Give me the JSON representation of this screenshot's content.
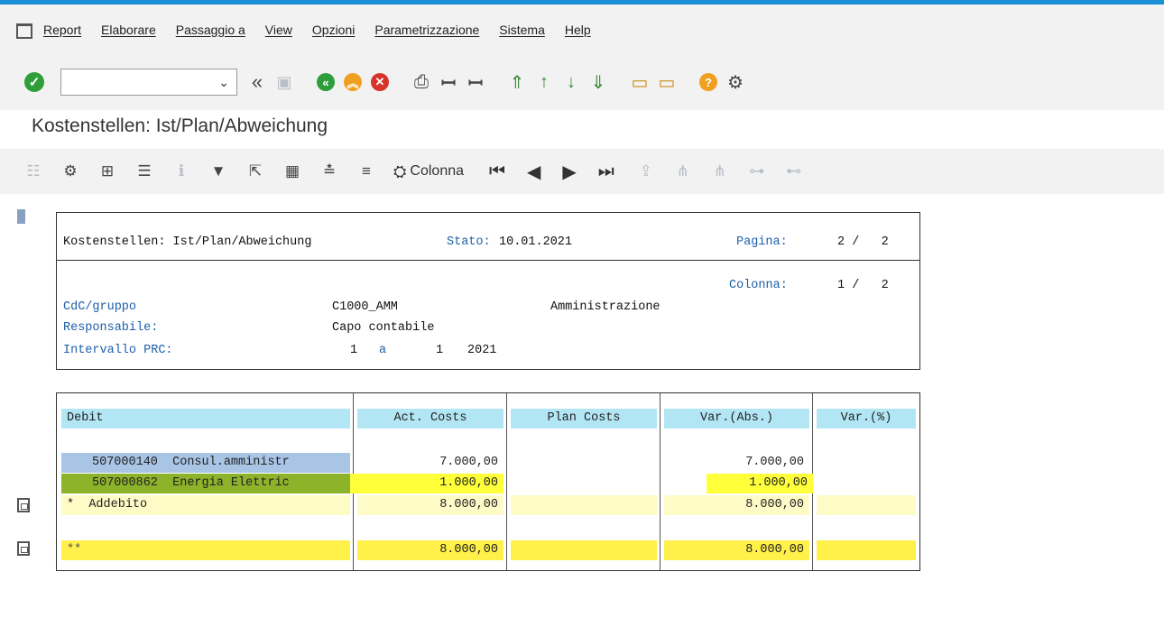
{
  "menu": [
    "Report",
    "Elaborare",
    "Passaggio a",
    "View",
    "Opzioni",
    "Parametrizzazione",
    "Sistema",
    "Help"
  ],
  "toolbar": {
    "command_value": "",
    "dropdown_glyph": "⌄",
    "icons": [
      "ok-icon",
      "back-double-arrow-icon",
      "save-icon",
      "back-icon",
      "exit-icon",
      "cancel-icon",
      "print-icon",
      "find-icon",
      "find-next-icon",
      "first-page-icon",
      "previous-page-icon",
      "next-page-icon",
      "last-page-icon",
      "create-session-icon",
      "shortcut-icon",
      "help-icon",
      "customize-layout-icon"
    ]
  },
  "title": "Kostenstellen: Ist/Plan/Abweichung",
  "app_toolbar": {
    "colonna_label": "Colonna"
  },
  "report": {
    "header": {
      "report_title": "Kostenstellen: Ist/Plan/Abweichung",
      "stato_label": "Stato:",
      "stato_value": "10.01.2021",
      "pagina_label": "Pagina:",
      "pagina_value": "2 /   2",
      "colonna_label": "Colonna:",
      "colonna_value": "1 /   2",
      "cdc_label": "CdC/gruppo",
      "cdc_value": "C1000_AMM",
      "cdc_desc": "Amministrazione",
      "resp_label": "Responsabile:",
      "resp_value": "Capo contabile",
      "interval_label": "Intervallo PRC:",
      "interval_from": "1",
      "interval_a": "a",
      "interval_to": "1",
      "interval_year": "2021"
    },
    "columns": [
      "Debit",
      "Act. Costs",
      "Plan Costs",
      "Var.(Abs.)",
      "Var.(%)"
    ],
    "rows": [
      {
        "account": "507000140",
        "name": "Consul.amministr",
        "act": "7.000,00",
        "plan": "",
        "var_abs": "7.000,00",
        "var_pct": ""
      },
      {
        "account": "507000862",
        "name": "Energia Elettric",
        "act": "1.000,00",
        "plan": "",
        "var_abs": "1.000,00",
        "var_pct": ""
      }
    ],
    "subtotal": {
      "marker": "*",
      "label": "Addebito",
      "act": "8.000,00",
      "var_abs": "8.000,00"
    },
    "total": {
      "marker": "**",
      "act": "8.000,00",
      "var_abs": "8.000,00"
    }
  },
  "colors": {
    "header_cell": "#b3e6f4",
    "row1_label": "#a8c5e6",
    "row2_label": "#8db32b",
    "highlight": "#ffff3a",
    "subtotal": "#fffbc6",
    "total": "#fff04a",
    "label_blue": "#1c5fa8"
  }
}
